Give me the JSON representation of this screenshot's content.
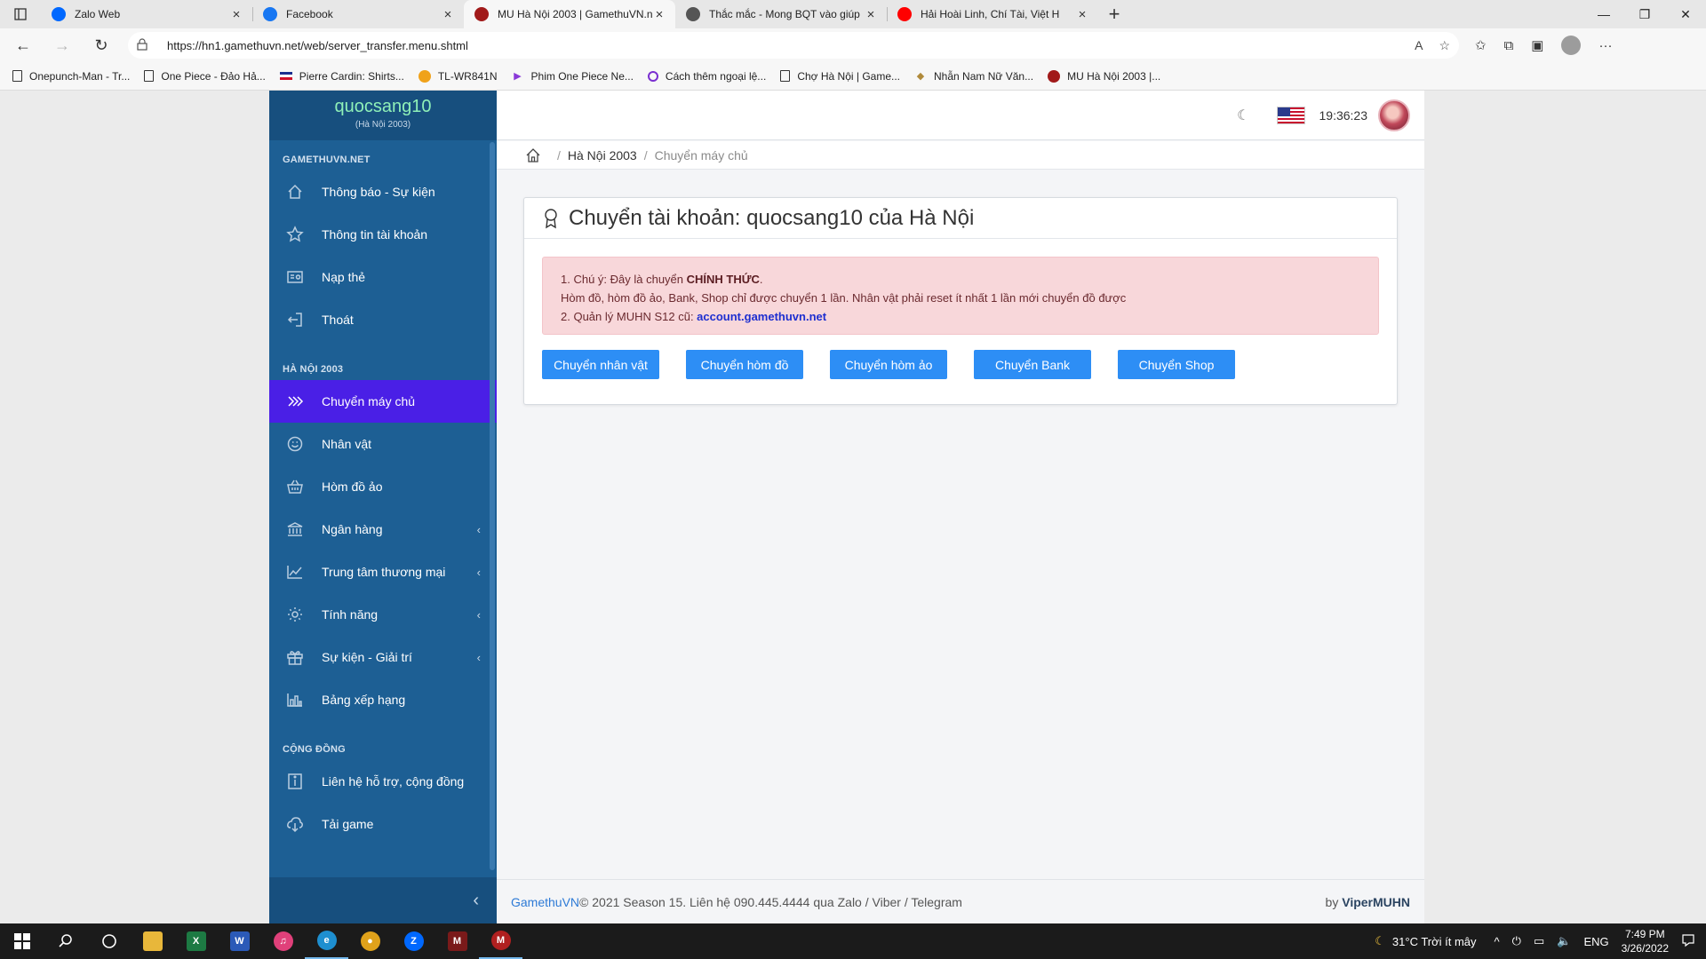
{
  "browser": {
    "tabs": [
      {
        "title": "Zalo Web",
        "favicon": "zalo-icon",
        "color": "#0068ff"
      },
      {
        "title": "Facebook",
        "favicon": "facebook-icon",
        "color": "#1877f2"
      },
      {
        "title": "MU Hà Nội 2003 | GamethuVN.n",
        "favicon": "mu-icon",
        "color": "#a11a1a"
      },
      {
        "title": "Thắc mắc - Mong BQT vào giúp",
        "favicon": "page-icon",
        "color": "#555555"
      },
      {
        "title": "Hải Hoài Linh, Chí Tài, Việt H",
        "favicon": "youtube-icon",
        "color": "#ff0000"
      }
    ],
    "url": "https://hn1.gamethuvn.net/web/server_transfer.menu.shtml",
    "bookmarks": [
      {
        "label": "Onepunch-Man - Tr...",
        "icon": "page-icon"
      },
      {
        "label": "One Piece - Đảo Hả...",
        "icon": "page-icon"
      },
      {
        "label": "Pierre Cardin: Shirts...",
        "icon": "flag-icon"
      },
      {
        "label": "TL-WR841N",
        "icon": "tplink-icon"
      },
      {
        "label": "Phim One Piece Ne...",
        "icon": "play-icon"
      },
      {
        "label": "Cách thêm ngoại lệ...",
        "icon": "circle-icon"
      },
      {
        "label": "Chợ Hà Nội | Game...",
        "icon": "page-icon"
      },
      {
        "label": "Nhẫn Nam Nữ Văn...",
        "icon": "ring-icon"
      },
      {
        "label": "MU Hà Nội 2003 |...",
        "icon": "mu-icon"
      }
    ]
  },
  "sidebar": {
    "username": "quocsang10",
    "server": "(Hà Nội 2003)",
    "sections": [
      {
        "title": "GAMETHUVN.NET",
        "items": [
          {
            "label": "Thông báo - Sự kiện",
            "icon": "home-icon",
            "chevron": false,
            "active": false
          },
          {
            "label": "Thông tin tài khoản",
            "icon": "star-icon",
            "chevron": false,
            "active": false
          },
          {
            "label": "Nạp thẻ",
            "icon": "card-icon",
            "chevron": false,
            "active": false
          },
          {
            "label": "Thoát",
            "icon": "logout-icon",
            "chevron": false,
            "active": false
          }
        ]
      },
      {
        "title": "HÀ NỘI 2003",
        "items": [
          {
            "label": "Chuyển máy chủ",
            "icon": "transfer-icon",
            "chevron": false,
            "active": true
          },
          {
            "label": "Nhân vật",
            "icon": "smile-icon",
            "chevron": false,
            "active": false
          },
          {
            "label": "Hòm đồ ảo",
            "icon": "basket-icon",
            "chevron": false,
            "active": false
          },
          {
            "label": "Ngân hàng",
            "icon": "bank-icon",
            "chevron": true,
            "active": false
          },
          {
            "label": "Trung tâm thương mại",
            "icon": "chart-icon",
            "chevron": true,
            "active": false
          },
          {
            "label": "Tính năng",
            "icon": "gear-icon",
            "chevron": true,
            "active": false
          },
          {
            "label": "Sự kiện - Giải trí",
            "icon": "gift-icon",
            "chevron": true,
            "active": false
          },
          {
            "label": "Bảng xếp hạng",
            "icon": "bar-chart-icon",
            "chevron": false,
            "active": false
          }
        ]
      },
      {
        "title": "CỘNG ĐỒNG",
        "items": [
          {
            "label": "Liên hệ hỗ trợ, cộng đồng",
            "icon": "info-icon",
            "chevron": false,
            "active": false
          },
          {
            "label": "Tải game",
            "icon": "download-icon",
            "chevron": false,
            "active": false
          }
        ]
      }
    ]
  },
  "topbar": {
    "time": "19:36:23"
  },
  "breadcrumb": {
    "level1": "Hà Nội 2003",
    "level2": "Chuyển máy chủ"
  },
  "card": {
    "title": "Chuyển tài khoản: quocsang10 của Hà Nội",
    "alert": {
      "line1_prefix": "1. Chú ý: Đây là chuyển ",
      "line1_bold": "CHÍNH THỨC",
      "line1_suffix": ".",
      "line2": "Hòm đồ, hòm đồ ảo, Bank, Shop chỉ được chuyển 1 lần. Nhân vật phải reset ít nhất 1 lần mới chuyển đồ được",
      "line3_prefix": "2. Quản lý MUHN S12 cũ: ",
      "line3_link": "account.gamethuvn.net"
    },
    "buttons": [
      "Chuyển nhân vật",
      "Chuyển hòm đồ",
      "Chuyển hòm ảo",
      "Chuyển Bank",
      "Chuyển Shop"
    ]
  },
  "footer": {
    "brand": "GamethuVN",
    "text": " © 2021 Season 15. Liên hệ 090.445.4444 qua Zalo / Viber / Telegram",
    "by_prefix": "by ",
    "by_name": "ViperMUHN"
  },
  "taskbar": {
    "weather": "31°C  Trời ít mây",
    "lang": "ENG",
    "time": "7:49 PM",
    "date": "3/26/2022",
    "apps": [
      {
        "name": "file-explorer-icon",
        "color": "#e8b73a",
        "label": ""
      },
      {
        "name": "excel-icon",
        "color": "#1d7a43",
        "label": "X"
      },
      {
        "name": "word-icon",
        "color": "#2b5ab8",
        "label": "W"
      },
      {
        "name": "itunes-icon",
        "color": "#e0407a",
        "label": "♫"
      },
      {
        "name": "edge-icon",
        "color": "#1e8fd0",
        "label": "e"
      },
      {
        "name": "chrome-icon",
        "color": "#e0a21b",
        "label": "●"
      },
      {
        "name": "zalo-icon",
        "color": "#0068ff",
        "label": "Z"
      },
      {
        "name": "game-icon",
        "color": "#7a1a1a",
        "label": "M"
      },
      {
        "name": "mu-icon",
        "color": "#b02020",
        "label": "M"
      }
    ]
  }
}
